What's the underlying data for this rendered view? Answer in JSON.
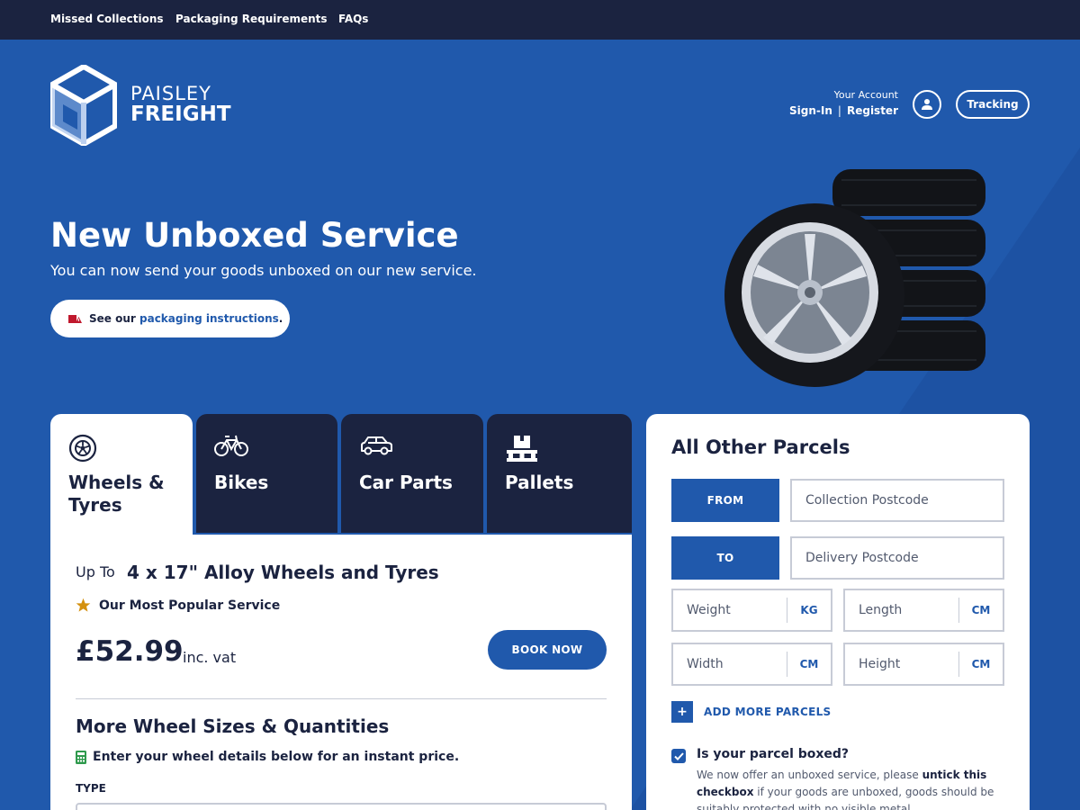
{
  "topnav": {
    "items": [
      "Missed Collections",
      "Packaging Requirements",
      "FAQs"
    ]
  },
  "brand": {
    "line1": "PAISLEY",
    "line2": "FREIGHT"
  },
  "account": {
    "caption": "Your Account",
    "sign_in": "Sign-In",
    "separator": "|",
    "register": "Register",
    "tracking": "Tracking",
    "avatar_icon": "user-icon"
  },
  "hero": {
    "title": "New Unboxed Service",
    "subtitle": "You can now send your goods unboxed on our new service.",
    "pill_prefix": "See our",
    "pill_link": "packaging instructions",
    "pill_suffix": ".",
    "pill_icon": "packaging-warning-icon"
  },
  "tabs": [
    {
      "label": "Wheels & Tyres",
      "icon": "wheel-icon",
      "active": true
    },
    {
      "label": "Bikes",
      "icon": "bike-icon",
      "active": false
    },
    {
      "label": "Car Parts",
      "icon": "car-icon",
      "active": false
    },
    {
      "label": "Pallets",
      "icon": "pallet-icon",
      "active": false
    }
  ],
  "service": {
    "up_to": "Up To",
    "size": "4 x 17\" Alloy Wheels and Tyres",
    "popular": "Our Most Popular Service",
    "price": "£52.99",
    "vat": "inc. vat",
    "book": "BOOK NOW",
    "more_title": "More Wheel Sizes & Quantities",
    "more_hint": "Enter your wheel details below for an instant price.",
    "type_label": "TYPE"
  },
  "parcels": {
    "title": "All Other Parcels",
    "from_label": "FROM",
    "from_placeholder": "Collection Postcode",
    "to_label": "TO",
    "to_placeholder": "Delivery Postcode",
    "weight_placeholder": "Weight",
    "weight_unit": "KG",
    "length_placeholder": "Length",
    "length_unit": "CM",
    "width_placeholder": "Width",
    "width_unit": "CM",
    "height_placeholder": "Height",
    "height_unit": "CM",
    "add_more_symbol": "+",
    "add_more": "ADD MORE PARCELS",
    "boxed_question": "Is your parcel boxed?",
    "boxed_checked": true,
    "boxed_note_1": "We now offer an unboxed service, please",
    "boxed_note_bold": "untick this checkbox",
    "boxed_note_2": "if your goods are unboxed, goods should be suitably protected with no visible metal."
  },
  "colors": {
    "brand_blue": "#2059ac",
    "navy": "#1b2340",
    "white": "#ffffff",
    "star": "#d4900e"
  }
}
